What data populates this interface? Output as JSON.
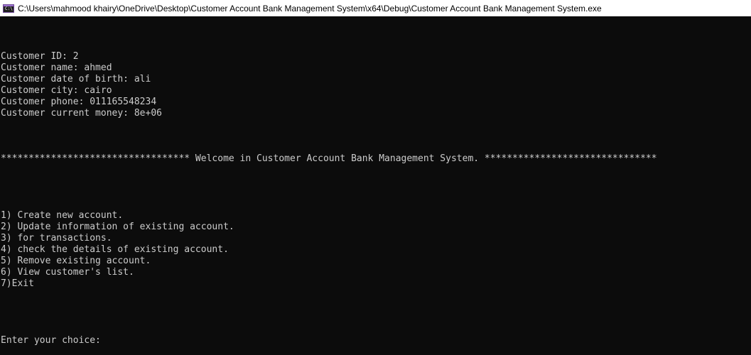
{
  "window": {
    "title": "C:\\Users\\mahmood khairy\\OneDrive\\Desktop\\Customer Account Bank Management System\\x64\\Debug\\Customer Account Bank Management System.exe",
    "icon": "console-app-icon"
  },
  "customer": {
    "id_line": "Customer ID: 2",
    "name_line": "Customer name: ahmed",
    "dob_line": "Customer date of birth: ali",
    "city_line": "Customer city: cairo",
    "phone_line": "Customer phone: 011165548234",
    "money_line": "Customer current money: 8e+06"
  },
  "banner": "********************************** Welcome in Customer Account Bank Management System. *******************************",
  "menu": [
    "1) Create new account.",
    "2) Update information of existing account.",
    "3) for transactions.",
    "4) check the details of existing account.",
    "5) Remove existing account.",
    "6) View customer's list.",
    "7)Exit"
  ],
  "prompt": "Enter your choice:",
  "colors": {
    "background": "#0c0c0c",
    "text": "#cccccc",
    "titlebar": "#ffffff"
  }
}
